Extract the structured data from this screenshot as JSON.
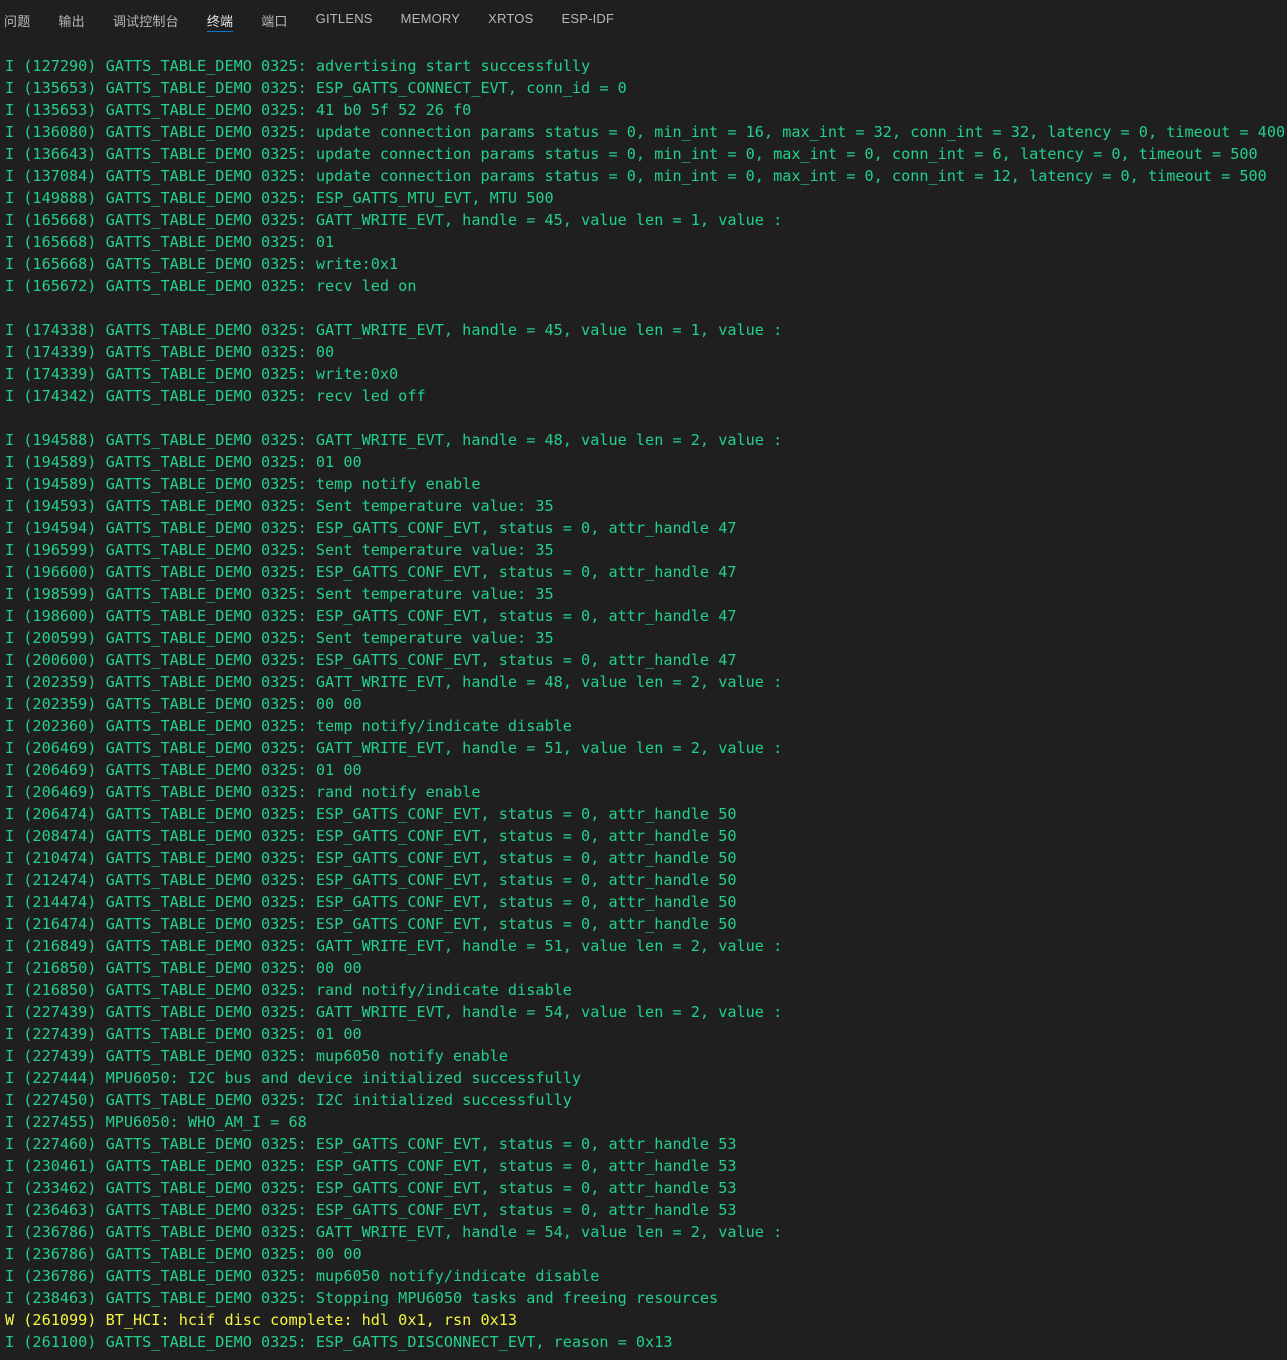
{
  "tabs": [
    {
      "label": "问题",
      "active": false,
      "name": "tab-problems"
    },
    {
      "label": "输出",
      "active": false,
      "name": "tab-output"
    },
    {
      "label": "调试控制台",
      "active": false,
      "name": "tab-debug-console"
    },
    {
      "label": "终端",
      "active": true,
      "name": "tab-terminal"
    },
    {
      "label": "端口",
      "active": false,
      "name": "tab-ports"
    },
    {
      "label": "GITLENS",
      "active": false,
      "name": "tab-gitlens"
    },
    {
      "label": "MEMORY",
      "active": false,
      "name": "tab-memory"
    },
    {
      "label": "XRTOS",
      "active": false,
      "name": "tab-xrtos"
    },
    {
      "label": "ESP-IDF",
      "active": false,
      "name": "tab-esp-idf"
    }
  ],
  "colors": {
    "background": "#1f1f1f",
    "info_text": "#23d18b",
    "warn_text": "#f5f543",
    "tab_active_underline": "#0078d4"
  },
  "terminal_lines": [
    {
      "level": "info",
      "text": "I (127290) GATTS_TABLE_DEMO 0325: advertising start successfully"
    },
    {
      "level": "info",
      "text": "I (135653) GATTS_TABLE_DEMO 0325: ESP_GATTS_CONNECT_EVT, conn_id = 0"
    },
    {
      "level": "info",
      "text": "I (135653) GATTS_TABLE_DEMO 0325: 41 b0 5f 52 26 f0"
    },
    {
      "level": "info",
      "text": "I (136080) GATTS_TABLE_DEMO 0325: update connection params status = 0, min_int = 16, max_int = 32, conn_int = 32, latency = 0, timeout = 400"
    },
    {
      "level": "info",
      "text": "I (136643) GATTS_TABLE_DEMO 0325: update connection params status = 0, min_int = 0, max_int = 0, conn_int = 6, latency = 0, timeout = 500"
    },
    {
      "level": "info",
      "text": "I (137084) GATTS_TABLE_DEMO 0325: update connection params status = 0, min_int = 0, max_int = 0, conn_int = 12, latency = 0, timeout = 500"
    },
    {
      "level": "info",
      "text": "I (149888) GATTS_TABLE_DEMO 0325: ESP_GATTS_MTU_EVT, MTU 500"
    },
    {
      "level": "info",
      "text": "I (165668) GATTS_TABLE_DEMO 0325: GATT_WRITE_EVT, handle = 45, value len = 1, value :"
    },
    {
      "level": "info",
      "text": "I (165668) GATTS_TABLE_DEMO 0325: 01"
    },
    {
      "level": "info",
      "text": "I (165668) GATTS_TABLE_DEMO 0325: write:0x1"
    },
    {
      "level": "info",
      "text": "I (165672) GATTS_TABLE_DEMO 0325: recv led on"
    },
    {
      "level": "info",
      "text": ""
    },
    {
      "level": "info",
      "text": "I (174338) GATTS_TABLE_DEMO 0325: GATT_WRITE_EVT, handle = 45, value len = 1, value :"
    },
    {
      "level": "info",
      "text": "I (174339) GATTS_TABLE_DEMO 0325: 00"
    },
    {
      "level": "info",
      "text": "I (174339) GATTS_TABLE_DEMO 0325: write:0x0"
    },
    {
      "level": "info",
      "text": "I (174342) GATTS_TABLE_DEMO 0325: recv led off"
    },
    {
      "level": "info",
      "text": ""
    },
    {
      "level": "info",
      "text": "I (194588) GATTS_TABLE_DEMO 0325: GATT_WRITE_EVT, handle = 48, value len = 2, value :"
    },
    {
      "level": "info",
      "text": "I (194589) GATTS_TABLE_DEMO 0325: 01 00"
    },
    {
      "level": "info",
      "text": "I (194589) GATTS_TABLE_DEMO 0325: temp notify enable"
    },
    {
      "level": "info",
      "text": "I (194593) GATTS_TABLE_DEMO 0325: Sent temperature value: 35"
    },
    {
      "level": "info",
      "text": "I (194594) GATTS_TABLE_DEMO 0325: ESP_GATTS_CONF_EVT, status = 0, attr_handle 47"
    },
    {
      "level": "info",
      "text": "I (196599) GATTS_TABLE_DEMO 0325: Sent temperature value: 35"
    },
    {
      "level": "info",
      "text": "I (196600) GATTS_TABLE_DEMO 0325: ESP_GATTS_CONF_EVT, status = 0, attr_handle 47"
    },
    {
      "level": "info",
      "text": "I (198599) GATTS_TABLE_DEMO 0325: Sent temperature value: 35"
    },
    {
      "level": "info",
      "text": "I (198600) GATTS_TABLE_DEMO 0325: ESP_GATTS_CONF_EVT, status = 0, attr_handle 47"
    },
    {
      "level": "info",
      "text": "I (200599) GATTS_TABLE_DEMO 0325: Sent temperature value: 35"
    },
    {
      "level": "info",
      "text": "I (200600) GATTS_TABLE_DEMO 0325: ESP_GATTS_CONF_EVT, status = 0, attr_handle 47"
    },
    {
      "level": "info",
      "text": "I (202359) GATTS_TABLE_DEMO 0325: GATT_WRITE_EVT, handle = 48, value len = 2, value :"
    },
    {
      "level": "info",
      "text": "I (202359) GATTS_TABLE_DEMO 0325: 00 00"
    },
    {
      "level": "info",
      "text": "I (202360) GATTS_TABLE_DEMO 0325: temp notify/indicate disable"
    },
    {
      "level": "info",
      "text": "I (206469) GATTS_TABLE_DEMO 0325: GATT_WRITE_EVT, handle = 51, value len = 2, value :"
    },
    {
      "level": "info",
      "text": "I (206469) GATTS_TABLE_DEMO 0325: 01 00"
    },
    {
      "level": "info",
      "text": "I (206469) GATTS_TABLE_DEMO 0325: rand notify enable"
    },
    {
      "level": "info",
      "text": "I (206474) GATTS_TABLE_DEMO 0325: ESP_GATTS_CONF_EVT, status = 0, attr_handle 50"
    },
    {
      "level": "info",
      "text": "I (208474) GATTS_TABLE_DEMO 0325: ESP_GATTS_CONF_EVT, status = 0, attr_handle 50"
    },
    {
      "level": "info",
      "text": "I (210474) GATTS_TABLE_DEMO 0325: ESP_GATTS_CONF_EVT, status = 0, attr_handle 50"
    },
    {
      "level": "info",
      "text": "I (212474) GATTS_TABLE_DEMO 0325: ESP_GATTS_CONF_EVT, status = 0, attr_handle 50"
    },
    {
      "level": "info",
      "text": "I (214474) GATTS_TABLE_DEMO 0325: ESP_GATTS_CONF_EVT, status = 0, attr_handle 50"
    },
    {
      "level": "info",
      "text": "I (216474) GATTS_TABLE_DEMO 0325: ESP_GATTS_CONF_EVT, status = 0, attr_handle 50"
    },
    {
      "level": "info",
      "text": "I (216849) GATTS_TABLE_DEMO 0325: GATT_WRITE_EVT, handle = 51, value len = 2, value :"
    },
    {
      "level": "info",
      "text": "I (216850) GATTS_TABLE_DEMO 0325: 00 00"
    },
    {
      "level": "info",
      "text": "I (216850) GATTS_TABLE_DEMO 0325: rand notify/indicate disable"
    },
    {
      "level": "info",
      "text": "I (227439) GATTS_TABLE_DEMO 0325: GATT_WRITE_EVT, handle = 54, value len = 2, value :"
    },
    {
      "level": "info",
      "text": "I (227439) GATTS_TABLE_DEMO 0325: 01 00"
    },
    {
      "level": "info",
      "text": "I (227439) GATTS_TABLE_DEMO 0325: mup6050 notify enable"
    },
    {
      "level": "info",
      "text": "I (227444) MPU6050: I2C bus and device initialized successfully"
    },
    {
      "level": "info",
      "text": "I (227450) GATTS_TABLE_DEMO 0325: I2C initialized successfully"
    },
    {
      "level": "info",
      "text": "I (227455) MPU6050: WHO_AM_I = 68"
    },
    {
      "level": "info",
      "text": "I (227460) GATTS_TABLE_DEMO 0325: ESP_GATTS_CONF_EVT, status = 0, attr_handle 53"
    },
    {
      "level": "info",
      "text": "I (230461) GATTS_TABLE_DEMO 0325: ESP_GATTS_CONF_EVT, status = 0, attr_handle 53"
    },
    {
      "level": "info",
      "text": "I (233462) GATTS_TABLE_DEMO 0325: ESP_GATTS_CONF_EVT, status = 0, attr_handle 53"
    },
    {
      "level": "info",
      "text": "I (236463) GATTS_TABLE_DEMO 0325: ESP_GATTS_CONF_EVT, status = 0, attr_handle 53"
    },
    {
      "level": "info",
      "text": "I (236786) GATTS_TABLE_DEMO 0325: GATT_WRITE_EVT, handle = 54, value len = 2, value :"
    },
    {
      "level": "info",
      "text": "I (236786) GATTS_TABLE_DEMO 0325: 00 00"
    },
    {
      "level": "info",
      "text": "I (236786) GATTS_TABLE_DEMO 0325: mup6050 notify/indicate disable"
    },
    {
      "level": "info",
      "text": "I (238463) GATTS_TABLE_DEMO 0325: Stopping MPU6050 tasks and freeing resources"
    },
    {
      "level": "warn",
      "text": "W (261099) BT_HCI: hcif disc complete: hdl 0x1, rsn 0x13"
    },
    {
      "level": "info",
      "text": "I (261100) GATTS_TABLE_DEMO 0325: ESP_GATTS_DISCONNECT_EVT, reason = 0x13"
    }
  ]
}
